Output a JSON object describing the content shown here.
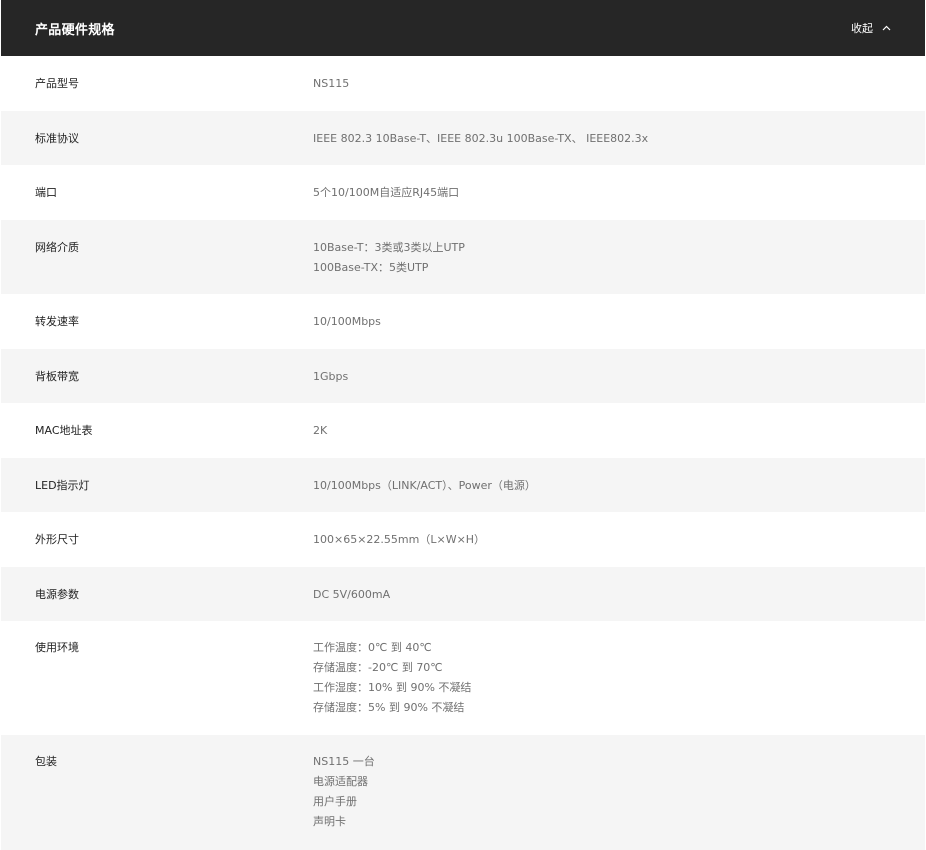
{
  "header": {
    "title": "产品硬件规格",
    "collapse_label": "收起"
  },
  "specs": [
    {
      "label": "产品型号",
      "lines": [
        "NS115"
      ]
    },
    {
      "label": "标准协议",
      "lines": [
        "IEEE 802.3 10Base-T、IEEE 802.3u 100Base-TX、 IEEE802.3x"
      ]
    },
    {
      "label": "端口",
      "lines": [
        "5个10/100M自适应RJ45端口"
      ]
    },
    {
      "label": "网络介质",
      "lines": [
        "10Base-T：3类或3类以上UTP",
        "100Base-TX：5类UTP"
      ]
    },
    {
      "label": "转发速率",
      "lines": [
        "10/100Mbps"
      ]
    },
    {
      "label": "背板带宽",
      "lines": [
        "1Gbps"
      ]
    },
    {
      "label": "MAC地址表",
      "lines": [
        "2K"
      ]
    },
    {
      "label": "LED指示灯",
      "lines": [
        "10/100Mbps（LINK/ACT）、Power（电源）"
      ]
    },
    {
      "label": "外形尺寸",
      "lines": [
        "100×65×22.55mm（L×W×H）"
      ]
    },
    {
      "label": "电源参数",
      "lines": [
        "DC 5V/600mA"
      ]
    },
    {
      "label": "使用环境",
      "lines": [
        "工作温度：0℃ 到 40℃",
        "存储温度：-20℃ 到 70℃",
        "工作湿度：10% 到 90% 不凝结",
        "存储湿度：5% 到 90% 不凝结"
      ]
    },
    {
      "label": "包装",
      "lines": [
        "NS115 一台",
        "电源适配器",
        "用户手册",
        "声明卡"
      ]
    }
  ]
}
